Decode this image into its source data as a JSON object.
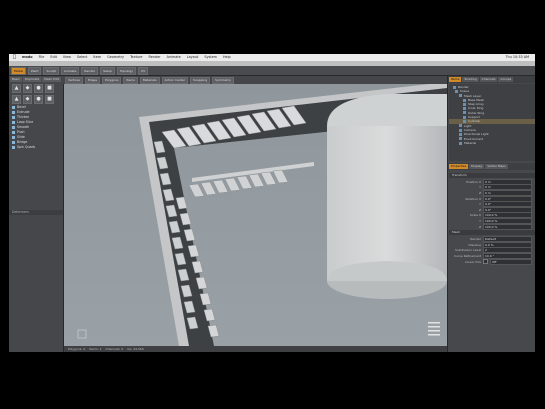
{
  "menubar": {
    "app": "modo",
    "items": [
      "File",
      "Edit",
      "View",
      "Select",
      "Item",
      "Geometry",
      "Texture",
      "Render",
      "Animate",
      "Layout",
      "System",
      "Help"
    ],
    "clock": "Thu 10:33 AM"
  },
  "window": {
    "title": "modo"
  },
  "toolbar": {
    "buttons": [
      "Model",
      "Paint",
      "Sculpt",
      "Animate",
      "Render",
      "Setup",
      "Topology",
      "UV"
    ],
    "active_index": 0
  },
  "subbar": {
    "buttons": [
      "Vertices",
      "Edges",
      "Polygons",
      "Items",
      "Materials",
      "Action Center",
      "Snapping",
      "Symmetry"
    ]
  },
  "left_panel": {
    "tabs": [
      "Basic",
      "Duplicate",
      "Mesh Edit",
      "Vertex",
      "Edge"
    ],
    "tool_icons": [
      "▲",
      "◆",
      "●",
      "■",
      "▲",
      "◆",
      "●",
      "■"
    ],
    "tools": [
      "Bevel",
      "Extrude",
      "Thicken",
      "Loop Slice",
      "Smooth",
      "Push",
      "Slide",
      "Bridge",
      "Spin Quads"
    ],
    "section_label": "Deformers"
  },
  "status": {
    "items": [
      "Polygons: 0",
      "Items: 1",
      "Channels: 0",
      "GL: 24,560"
    ]
  },
  "right_panel": {
    "tabs": [
      "Items",
      "Shading",
      "Channels",
      "Groups"
    ],
    "active_tab": 0,
    "tree": [
      "Render",
      "Scene",
      "Mesh Layer",
      "Base Mesh",
      "Step Array",
      "Inner Ring",
      "Outer Ring",
      "Support",
      "Cylinder",
      "Light",
      "Camera",
      "Directional Light",
      "Environment",
      "Material"
    ],
    "selected_index": 8,
    "prop_tabs": [
      "Properties",
      "Display",
      "Vertex Maps"
    ],
    "prop_section_1": "Transform",
    "props_1": [
      {
        "label": "Position X",
        "value": "0 m"
      },
      {
        "label": "Y",
        "value": "0 m"
      },
      {
        "label": "Z",
        "value": "0 m"
      },
      {
        "label": "Rotation X",
        "value": "0.0°"
      },
      {
        "label": "Y",
        "value": "0.0°"
      },
      {
        "label": "Z",
        "value": "0.0°"
      },
      {
        "label": "Scale X",
        "value": "100.0 %"
      },
      {
        "label": "Y",
        "value": "100.0 %"
      },
      {
        "label": "Z",
        "value": "100.0 %"
      }
    ],
    "prop_section_2": "Mesh",
    "props_2": [
      {
        "label": "Render",
        "value": "Default"
      },
      {
        "label": "Dissolve",
        "value": "0.0 %"
      },
      {
        "label": "Subdivision Level",
        "value": "2"
      },
      {
        "label": "Curve Refinement",
        "value": "10.0 °"
      },
      {
        "label": "Linear UVs",
        "value": "Off"
      }
    ]
  },
  "colors": {
    "accent": "#d08a2a",
    "viewport_bg": "#8b939a",
    "panel": "#46474a"
  },
  "icons": {
    "axis": "axis-gizmo-icon",
    "apple": "apple-icon"
  }
}
